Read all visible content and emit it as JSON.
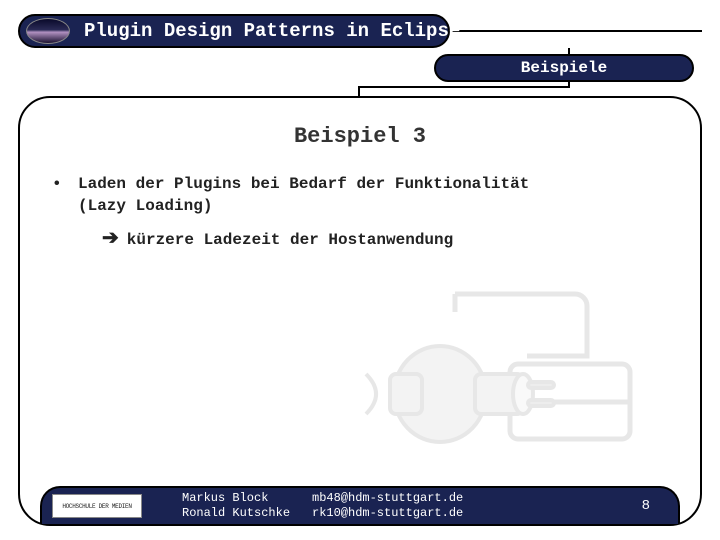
{
  "header": {
    "title": "Plugin Design Patterns in Eclipse",
    "subtitle": "Beispiele"
  },
  "content": {
    "heading": "Beispiel 3",
    "bullet_line1": "Laden der Plugins bei Bedarf der Funktionalität",
    "bullet_line2": "(Lazy Loading)",
    "sub_bullet": "kürzere Ladezeit der Hostanwendung",
    "arrow": "➔"
  },
  "footer": {
    "logo_text": "HOCHSCHULE DER MEDIEN",
    "author1": {
      "name": "Markus Block",
      "email": "mb48@hdm-stuttgart.de"
    },
    "author2": {
      "name": "Ronald Kutschke",
      "email": "rk10@hdm-stuttgart.de"
    },
    "page": "8"
  }
}
